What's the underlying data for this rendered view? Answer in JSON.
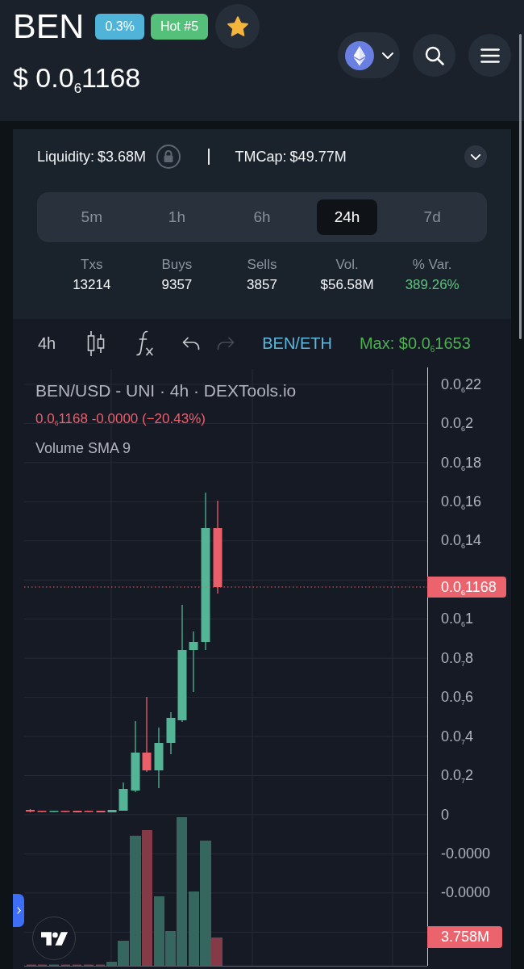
{
  "header": {
    "symbol": "BEN",
    "badges": [
      {
        "text": "0.3%",
        "color": "#4fb4d8"
      },
      {
        "text": "Hot #5",
        "color": "#55c07a"
      }
    ],
    "favorited": true,
    "price": "$ 0.0$_{6}$1168"
  },
  "summary": {
    "liquidity": {
      "label": "Liquidity:",
      "value": "$3.68M"
    },
    "market_cap": {
      "label": "TMCap:",
      "value": "$49.77M"
    },
    "periods": [
      {
        "label": "5m",
        "selected": false
      },
      {
        "label": "1h",
        "selected": false
      },
      {
        "label": "6h",
        "selected": false
      },
      {
        "label": "24h",
        "selected": true
      },
      {
        "label": "7d",
        "selected": false
      }
    ],
    "stats": [
      {
        "label": "Txs",
        "value": "13214",
        "kind": "plain"
      },
      {
        "label": "Buys",
        "value": "9357",
        "kind": "plain"
      },
      {
        "label": "Sells",
        "value": "3857",
        "kind": "plain"
      },
      {
        "label": "Vol.",
        "value": "$56.58M",
        "kind": "plain"
      },
      {
        "label": "% Var.",
        "value": "389.26%",
        "kind": "gain"
      }
    ]
  },
  "chart": {
    "toolbar": {
      "interval": "4h",
      "undo": {
        "disabled": false
      },
      "redo": {
        "disabled": true
      },
      "pair": "BEN/ETH",
      "max": "Max: $0.0$_{6}$1653"
    },
    "legend": {
      "title": "BEN/USD - UNI · 4h · DEXTools.io",
      "quote": {
        "text": "0.0$_{6}$1168 -0.0000 (−20.43%)",
        "kind": "down"
      },
      "indicator": "Volume SMA 9"
    },
    "price_axis": [
      "0.0$_{6}$22",
      "0.0$_{6}$2",
      "0.0$_{6}$18",
      "0.0$_{6}$16",
      "0.0$_{6}$14",
      "0.0$_{6}$1",
      "0.0$_{7}$8",
      "0.0$_{7}$6",
      "0.0$_{7}$4",
      "0.0$_{7}$2",
      "0",
      "-0.0000",
      "-0.0000"
    ],
    "last_price": "0.0$_{6}$1168",
    "last_volume": "3.758M"
  }
}
